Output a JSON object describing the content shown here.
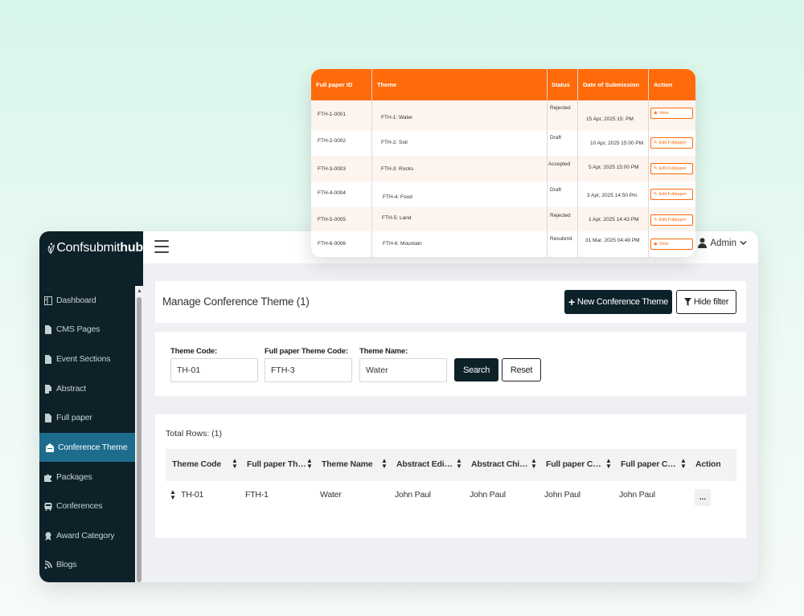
{
  "app": {
    "brand_regular": "Confsubmit",
    "brand_bold": "hub",
    "user_label": "Admin",
    "accent": "#1d6c8c",
    "dark": "#0d2129",
    "orange": "#ff6a0a"
  },
  "sidebar": {
    "items": [
      {
        "label": "Dashboard",
        "icon": "dashboard-icon"
      },
      {
        "label": "CMS Pages",
        "icon": "file-icon"
      },
      {
        "label": "Event Sections",
        "icon": "file-icon"
      },
      {
        "label": "Abstract",
        "icon": "document-icon"
      },
      {
        "label": "Full paper",
        "icon": "document-icon"
      },
      {
        "label": "Conference Theme",
        "icon": "building-icon",
        "active": true
      },
      {
        "label": "Packages",
        "icon": "puzzle-icon"
      },
      {
        "label": "Conferences",
        "icon": "bus-icon"
      },
      {
        "label": "Award Category",
        "icon": "award-icon"
      },
      {
        "label": "Blogs",
        "icon": "blog-icon"
      }
    ]
  },
  "page": {
    "title": "Manage Conference Theme (1)",
    "new_button": "New Conference Theme",
    "hide_filter": "Hide filter"
  },
  "filter": {
    "theme_code_label": "Theme Code:",
    "theme_code_value": "TH-01",
    "fp_code_label": "Full paper Theme Code:",
    "fp_code_value": "FTH-3",
    "theme_name_label": "Theme Name:",
    "theme_name_value": "Water",
    "search": "Search",
    "reset": "Reset"
  },
  "table": {
    "total": "Total Rows: (1)",
    "columns": [
      "Theme Code",
      "Full paper Theme Code",
      "Theme Name",
      "Abstract Editor",
      "Abstract Chief Editor",
      "Full paper Co-ordinator",
      "Full paper Chief Editor",
      "Action"
    ],
    "rows": [
      [
        "TH-01",
        "FTH-1",
        "Water",
        "John Paul",
        "John Paul",
        "John Paul",
        "John Paul"
      ]
    ],
    "more": "..."
  },
  "float_table": {
    "columns": [
      "Full paper ID",
      "Theme",
      "Status",
      "Date of Submission",
      "Action"
    ],
    "rows": [
      {
        "id": "FTH-1-0001",
        "theme": "FTH-1: Water",
        "status": "Rejected",
        "date": "15 Apr, 2025 15: PM",
        "action": "View"
      },
      {
        "id": "FTH-2-0002",
        "theme": "FTH-2: Soil",
        "status": "Draft",
        "date": "10 Apr, 2025 15:00 PM",
        "action": "Edit Fullpaper"
      },
      {
        "id": "FTH-3-0003",
        "theme": "FTH-3: Rocks",
        "status": "Accepted",
        "date": "5 Apr, 2025 15:00 PM",
        "action": "Edit Fullpaper"
      },
      {
        "id": "FTH-4-0004",
        "theme": "FTH-4: Food",
        "status": "Draft",
        "date": "3 Apr, 2025 14:50 Pm",
        "action": "Edit Fullpaper"
      },
      {
        "id": "FTH-5-0005",
        "theme": "FTH-5: Land",
        "status": "Rejected",
        "date": "1 Apr, 2025 14:43 PM",
        "action": "Edit Fullpaper"
      },
      {
        "id": "FTH-6-0006",
        "theme": "FTH-6: Mountain",
        "status": "Resubmit",
        "date": "31 Mar, 2025 04:49 PM",
        "action": "View"
      }
    ]
  }
}
